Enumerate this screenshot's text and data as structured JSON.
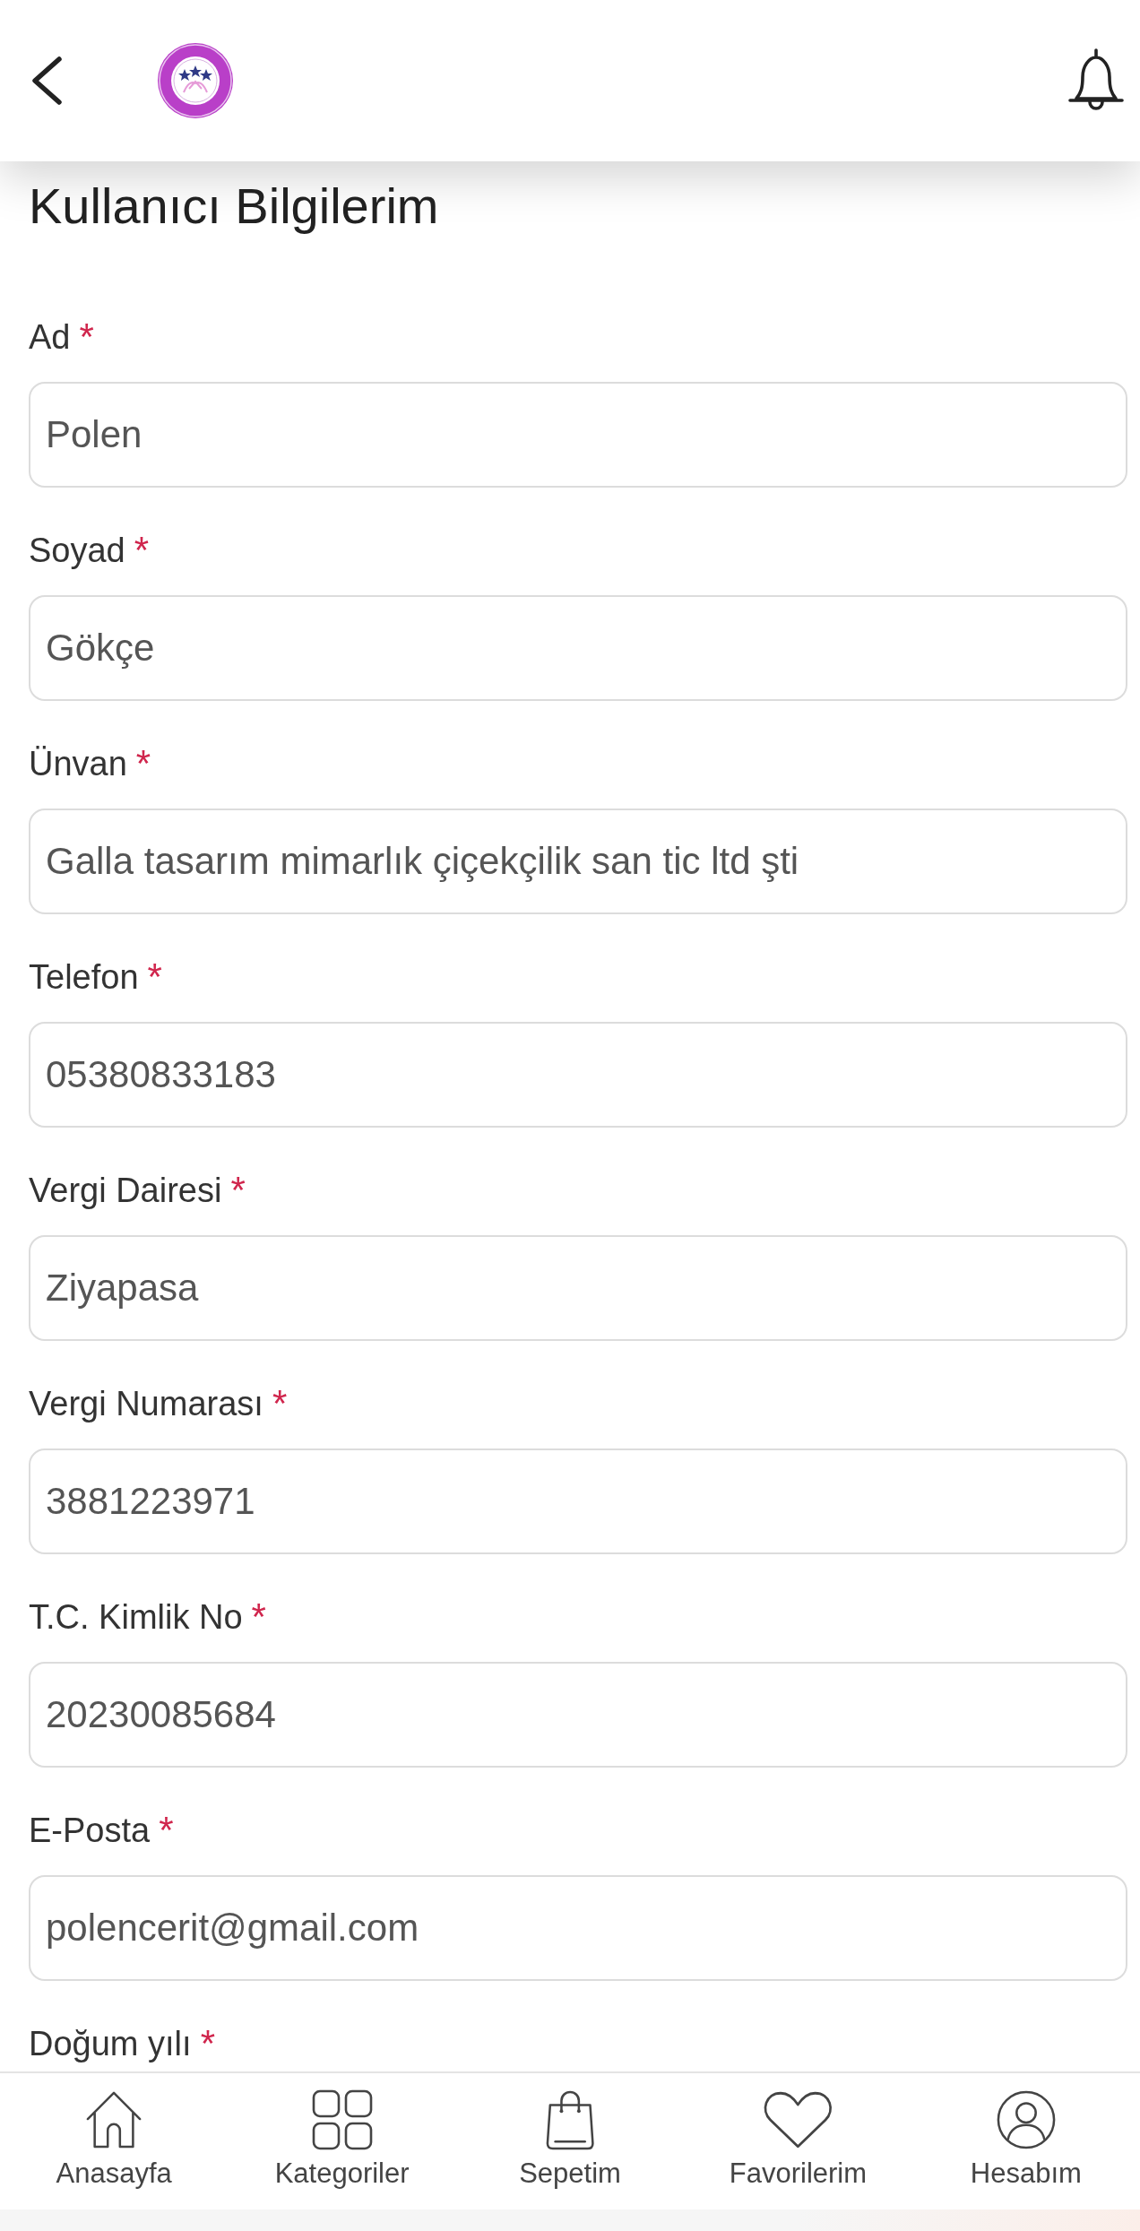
{
  "title": "Kullanıcı Bilgilerim",
  "form": {
    "fields": [
      {
        "label": "Ad",
        "required_mark": "*",
        "value": "Polen"
      },
      {
        "label": "Soyad",
        "required_mark": "*",
        "value": "Gökçe"
      },
      {
        "label": "Ünvan",
        "required_mark": "*",
        "value": "Galla tasarım mimarlık çiçekçilik san tic ltd şti"
      },
      {
        "label": "Telefon",
        "required_mark": "*",
        "value": "05380833183"
      },
      {
        "label": "Vergi Dairesi",
        "required_mark": "*",
        "value": "Ziyapasa"
      },
      {
        "label": "Vergi Numarası",
        "required_mark": "*",
        "value": "3881223971"
      },
      {
        "label": "T.C. Kimlik No",
        "required_mark": "*",
        "value": "20230085684"
      },
      {
        "label": "E-Posta",
        "required_mark": "*",
        "value": "polencerit@gmail.com"
      },
      {
        "label": "Doğum yılı",
        "required_mark": "*"
      }
    ]
  },
  "bottom_nav": {
    "items": [
      {
        "label": "Anasayfa",
        "kind": "home"
      },
      {
        "label": "Kategoriler",
        "kind": "categories"
      },
      {
        "label": "Sepetim",
        "kind": "cart"
      },
      {
        "label": "Favorilerim",
        "kind": "favorites"
      },
      {
        "label": "Hesabım",
        "kind": "account"
      }
    ]
  }
}
